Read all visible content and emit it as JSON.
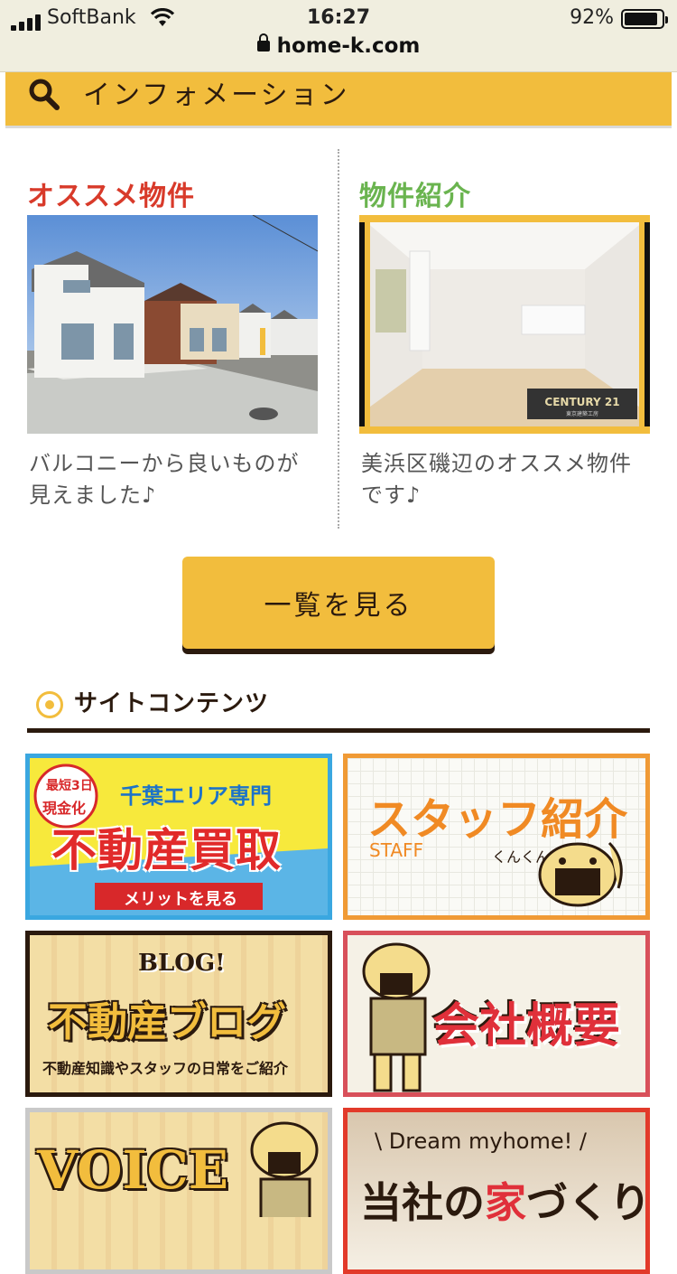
{
  "status_bar": {
    "carrier": "SoftBank",
    "time": "16:27",
    "battery_percent": "92%",
    "url": "home-k.com"
  },
  "info_bar": {
    "label": "インフォメーション"
  },
  "featured": {
    "left": {
      "heading": "オススメ物件",
      "caption": "バルコニーから良いものが見えました♪"
    },
    "right": {
      "heading": "物件紹介",
      "caption": "美浜区磯辺のオススメ物件です♪",
      "photo_logo": "CENTURY 21",
      "photo_logo_sub": "東京建築工房"
    }
  },
  "view_all_button": "一覧を見る",
  "site_contents": {
    "title": "サイトコンテンツ",
    "banners": {
      "kaitori": {
        "badge_top": "最短3日",
        "badge_bottom": "現金化",
        "sub": "千葉エリア専門",
        "main": "不動産買取",
        "cta": "メリットを見る"
      },
      "staff": {
        "main": "スタッフ紹介",
        "sub": "STAFF",
        "sound": "くんくん"
      },
      "blog": {
        "tag": "BLOG!",
        "main": "不動産ブログ",
        "sub": "不動産知識やスタッフの日常をご紹介"
      },
      "company": {
        "main": "会社概要"
      },
      "voice": {
        "main": "VOICE"
      },
      "dream": {
        "sub": "\\ Dream myhome! /",
        "main": "当社の家づくり",
        "accent": "家"
      }
    }
  },
  "colors": {
    "brand_yellow": "#f2bd3d",
    "dark_brown": "#2b1a0e",
    "red": "#d83a2a",
    "green": "#6ab44f"
  }
}
